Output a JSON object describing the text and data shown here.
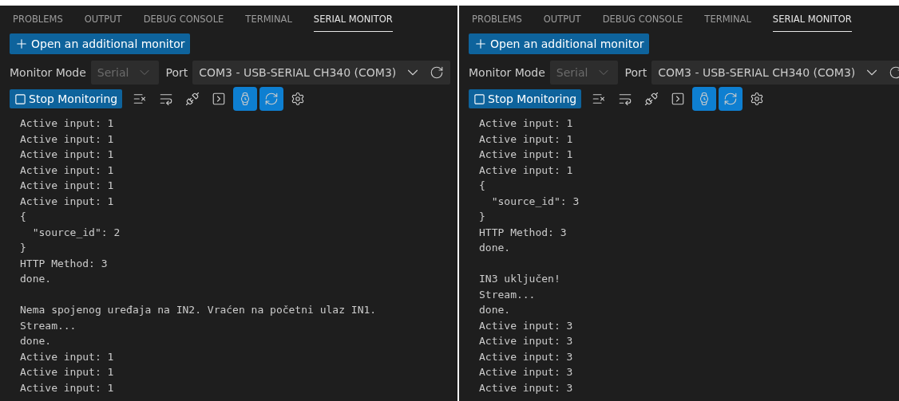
{
  "panels": [
    {
      "tabs": [
        {
          "label": "PROBLEMS",
          "selected": false
        },
        {
          "label": "OUTPUT",
          "selected": false
        },
        {
          "label": "DEBUG CONSOLE",
          "selected": false
        },
        {
          "label": "TERMINAL",
          "selected": false
        },
        {
          "label": "SERIAL MONITOR",
          "selected": true
        }
      ],
      "open_monitor_button": "Open an additional monitor",
      "monitor_mode": {
        "label": "Monitor Mode",
        "value": "Serial",
        "disabled": true
      },
      "port": {
        "label": "Port",
        "value": "COM3 - USB-SERIAL CH340 (COM3)"
      },
      "stop_button": "Stop Monitoring",
      "toolbar": [
        {
          "kind": "clear",
          "on": false
        },
        {
          "kind": "wrap",
          "on": false
        },
        {
          "kind": "disconnect",
          "on": false
        },
        {
          "kind": "terminal",
          "on": false
        },
        {
          "kind": "timestamp",
          "on": true
        },
        {
          "kind": "autoscroll",
          "on": true
        },
        {
          "kind": "settings",
          "on": false
        }
      ],
      "output": [
        {
          "lines": [
            "Active input: 1",
            "Active input: 1",
            "Active input: 1",
            "Active input: 1",
            "Active input: 1",
            "Active input: 1",
            "{",
            "  \"source_id\": 2",
            "}",
            "HTTP Method: 3",
            "done."
          ]
        },
        {
          "lines": [
            "Nema spojenog uređaja na IN2. Vraćen na početni ulaz IN1.",
            "Stream...",
            "done.",
            "Active input: 1",
            "Active input: 1",
            "Active input: 1"
          ]
        }
      ]
    },
    {
      "tabs": [
        {
          "label": "PROBLEMS",
          "selected": false
        },
        {
          "label": "OUTPUT",
          "selected": false
        },
        {
          "label": "DEBUG CONSOLE",
          "selected": false
        },
        {
          "label": "TERMINAL",
          "selected": false
        },
        {
          "label": "SERIAL MONITOR",
          "selected": true
        }
      ],
      "open_monitor_button": "Open an additional monitor",
      "monitor_mode": {
        "label": "Monitor Mode",
        "value": "Serial",
        "disabled": true
      },
      "port": {
        "label": "Port",
        "value": "COM3 - USB-SERIAL CH340 (COM3)"
      },
      "stop_button": "Stop Monitoring",
      "toolbar": [
        {
          "kind": "clear",
          "on": false
        },
        {
          "kind": "wrap",
          "on": false
        },
        {
          "kind": "disconnect",
          "on": false
        },
        {
          "kind": "terminal",
          "on": false
        },
        {
          "kind": "timestamp",
          "on": true
        },
        {
          "kind": "autoscroll",
          "on": true
        },
        {
          "kind": "settings",
          "on": false
        }
      ],
      "output": [
        {
          "lines": [
            "Active input: 1",
            "Active input: 1",
            "Active input: 1",
            "Active input: 1",
            "{",
            "  \"source_id\": 3",
            "}",
            "HTTP Method: 3",
            "done."
          ]
        },
        {
          "lines": [
            "IN3 uključen!",
            "Stream...",
            "done.",
            "Active input: 3",
            "Active input: 3",
            "Active input: 3",
            "Active input: 3",
            "Active input: 3"
          ]
        }
      ]
    }
  ]
}
